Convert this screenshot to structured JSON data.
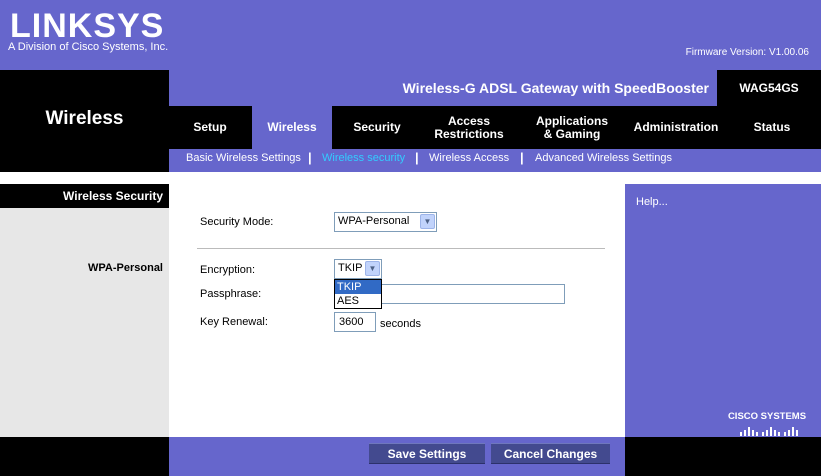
{
  "brand": {
    "logo_text": "LINKSYS",
    "subtitle": "A Division of Cisco Systems, Inc.",
    "firmware": "Firmware Version: V1.00.06",
    "cisco_text": "CISCO SYSTEMS"
  },
  "product": {
    "name": "Wireless-G ADSL Gateway with SpeedBooster",
    "model": "WAG54GS"
  },
  "section_title": "Wireless",
  "tabs": [
    {
      "label": "Setup"
    },
    {
      "label": "Wireless"
    },
    {
      "label": "Security"
    },
    {
      "label": "Access Restrictions"
    },
    {
      "label": "Applications & Gaming"
    },
    {
      "label": "Administration"
    },
    {
      "label": "Status"
    }
  ],
  "subnav": [
    {
      "label": "Basic Wireless Settings"
    },
    {
      "label": "Wireless security"
    },
    {
      "label": "Wireless Access"
    },
    {
      "label": "Advanced Wireless Settings"
    }
  ],
  "left": {
    "title": "Wireless Security",
    "subtitle": "WPA-Personal"
  },
  "form": {
    "security_mode_label": "Security Mode:",
    "security_mode_value": "WPA-Personal",
    "encryption_label": "Encryption:",
    "encryption_value": "TKIP",
    "encryption_options": [
      "TKIP",
      "AES"
    ],
    "passphrase_label": "Passphrase:",
    "passphrase_value": "",
    "key_renewal_label": "Key Renewal:",
    "key_renewal_value": "3600",
    "key_renewal_unit": "seconds"
  },
  "help": "Help...",
  "buttons": {
    "save": "Save Settings",
    "cancel": "Cancel Changes"
  },
  "colors": {
    "accent": "#6666cc",
    "dark": "#000000",
    "active_link": "#33ccff"
  }
}
